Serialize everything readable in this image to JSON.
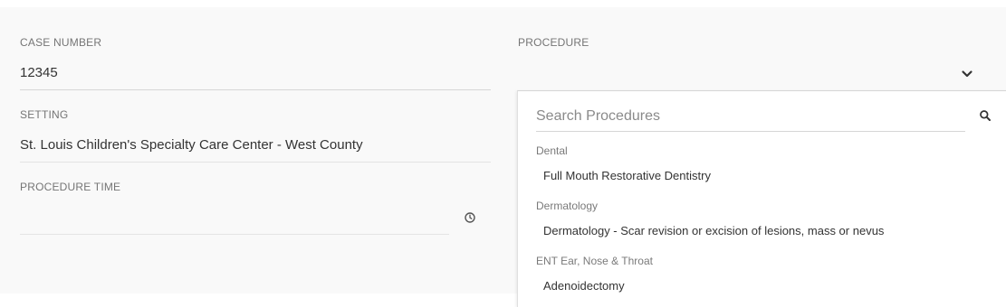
{
  "fields": {
    "case_number": {
      "label": "CASE NUMBER",
      "value": "12345"
    },
    "setting": {
      "label": "SETTING",
      "value": "St. Louis Children's Specialty Care Center - West County"
    },
    "procedure_time": {
      "label": "PROCEDURE TIME",
      "value": ""
    },
    "procedure": {
      "label": "PROCEDURE",
      "value": ""
    }
  },
  "dropdown": {
    "search_placeholder": "Search Procedures",
    "groups": [
      {
        "label": "Dental",
        "options": [
          "Full Mouth Restorative Dentistry"
        ]
      },
      {
        "label": "Dermatology",
        "options": [
          "Dermatology - Scar revision or excision of lesions, mass or nevus"
        ]
      },
      {
        "label": "ENT Ear, Nose & Throat",
        "options": [
          "Adenoidectomy"
        ]
      }
    ]
  },
  "icons": {
    "clock": "clock-icon",
    "chevron": "chevron-down-icon",
    "search": "search-icon"
  }
}
